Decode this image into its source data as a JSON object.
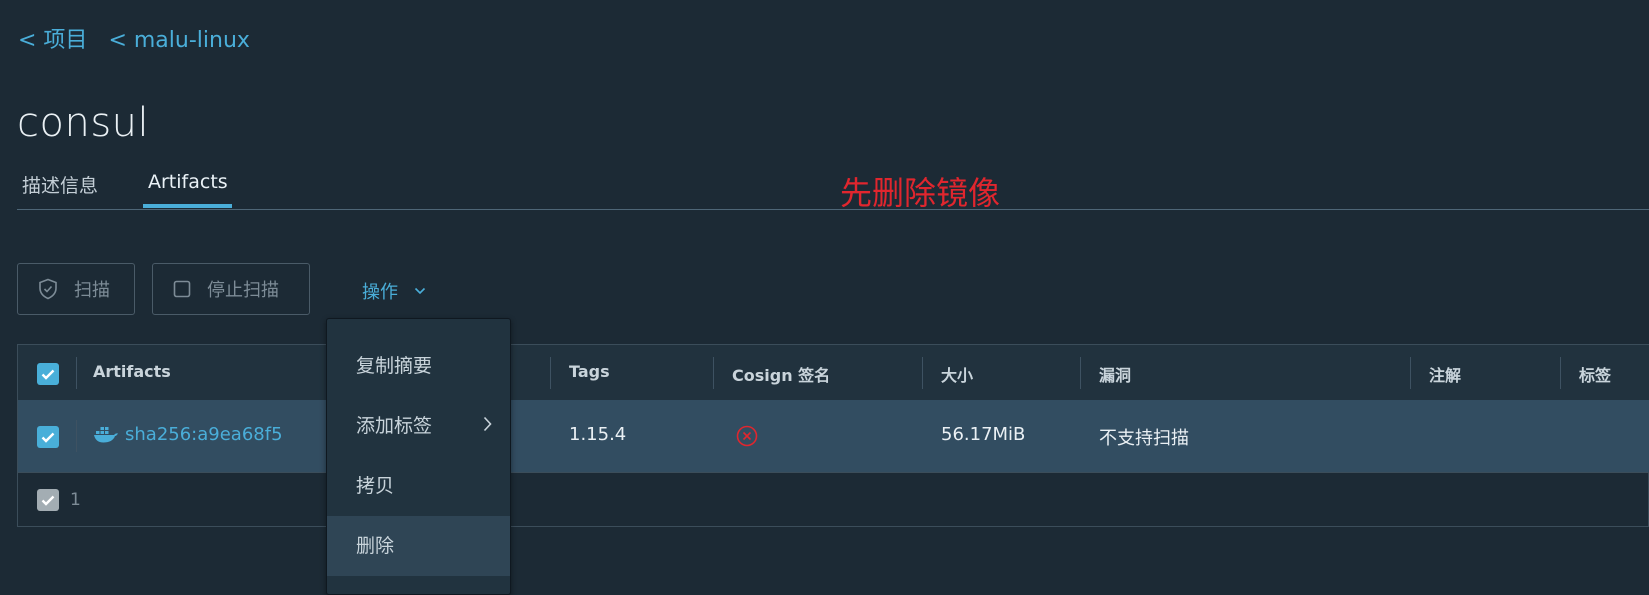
{
  "breadcrumb": {
    "items": [
      "< 项目",
      "< malu-linux"
    ]
  },
  "page_title": "consul",
  "tabs": {
    "items": [
      "描述信息",
      "Artifacts"
    ],
    "active": "Artifacts"
  },
  "annotation": "先删除镜像",
  "toolbar": {
    "scan_label": "扫描",
    "stop_scan_label": "停止扫描",
    "actions_label": "操作"
  },
  "grid": {
    "columns": [
      "Artifacts",
      "Tags",
      "Cosign 签名",
      "大小",
      "漏洞",
      "注解",
      "标签"
    ],
    "rows": [
      {
        "artifact": "sha256:a9ea68f5",
        "tags": "1.15.4",
        "cosign_icon": "x-circle-icon",
        "size": "56.17MiB",
        "vulnerabilities": "不支持扫描",
        "annotations": "",
        "labels": "",
        "selected": true
      }
    ],
    "footer_count": "1"
  },
  "actions_menu": {
    "items": [
      "复制摘要",
      "添加标签",
      "拷贝",
      "删除"
    ],
    "highlighted": "删除"
  },
  "colors": {
    "background": "#1c2a35",
    "accent": "#49afd9",
    "selected_row": "#324d61",
    "annotation_red": "#e0262e",
    "error_red": "#e0262e"
  }
}
